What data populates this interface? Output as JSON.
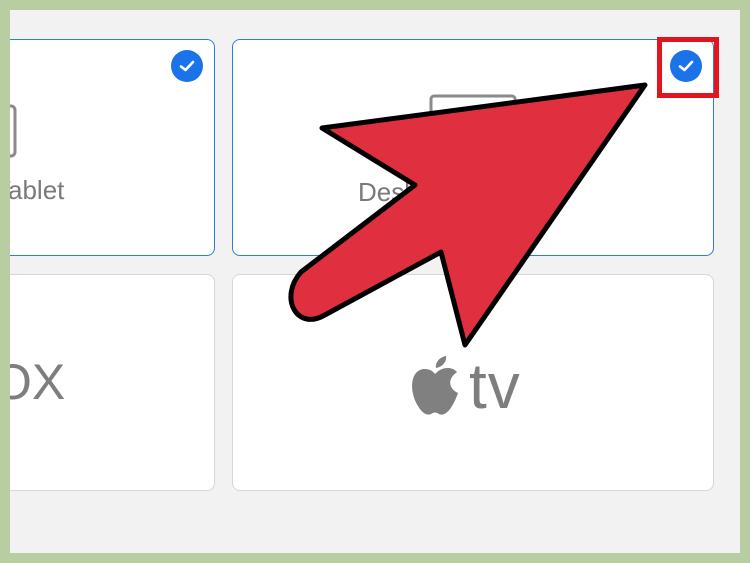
{
  "devices": [
    {
      "label": "Tablet",
      "selected": true,
      "icon": "tablet-icon"
    },
    {
      "label": "Desktop",
      "selected": true,
      "icon": "desktop-icon"
    },
    {
      "label": "OX",
      "selected": false,
      "icon": "xbox-wordmark"
    },
    {
      "label": "tv",
      "selected": false,
      "icon": "apple-logo-icon"
    }
  ],
  "colors": {
    "frame": "#b9cda2",
    "panel": "#f2f2f2",
    "check": "#1a73e8",
    "highlight": "#e3141e",
    "arrow": "#e03040"
  },
  "annotation": {
    "type": "pointer-arrow",
    "target": "desktop-checkmark"
  }
}
